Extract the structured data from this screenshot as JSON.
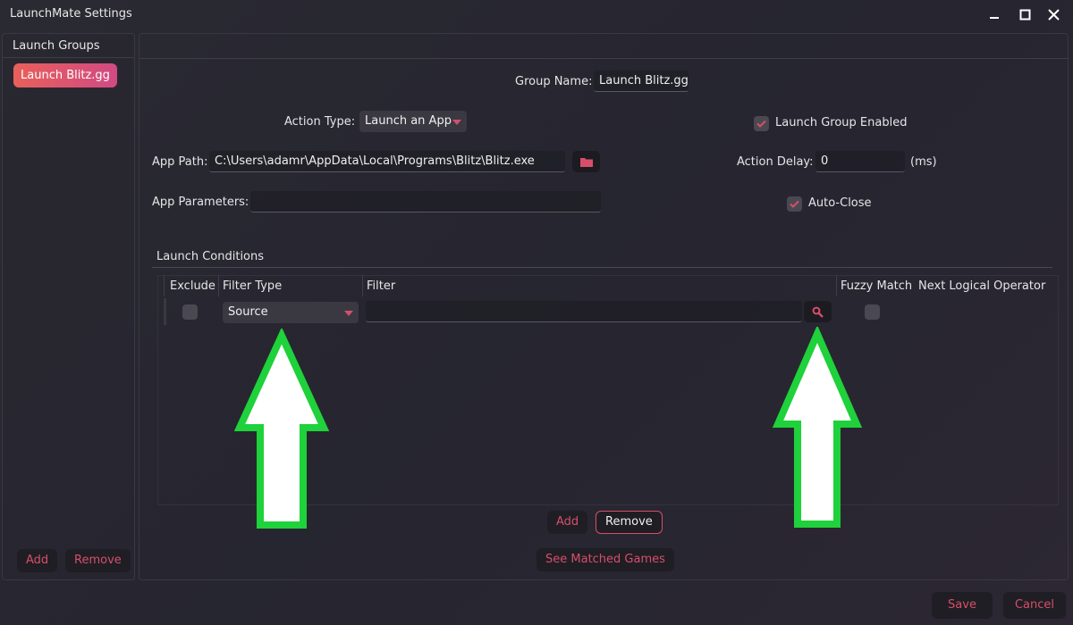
{
  "window": {
    "title": "LaunchMate Settings"
  },
  "sidebar": {
    "title": "Launch Groups",
    "groups": [
      {
        "label": "Launch Blitz.gg"
      }
    ],
    "add_label": "Add",
    "remove_label": "Remove"
  },
  "form": {
    "group_name_label": "Group Name:",
    "group_name_value": "Launch Blitz.gg",
    "action_type_label": "Action Type:",
    "action_type_value": "Launch an App",
    "launch_group_enabled_label": "Launch Group Enabled",
    "launch_group_enabled_checked": true,
    "app_path_label": "App Path:",
    "app_path_value": "C:\\Users\\adamr\\AppData\\Local\\Programs\\Blitz\\Blitz.exe",
    "action_delay_label": "Action Delay:",
    "action_delay_value": "0",
    "action_delay_unit": "(ms)",
    "app_parameters_label": "App Parameters:",
    "app_parameters_value": "",
    "auto_close_label": "Auto-Close",
    "auto_close_checked": true
  },
  "conditions": {
    "title": "Launch Conditions",
    "columns": [
      "Exclude",
      "Filter Type",
      "Filter",
      "Fuzzy Match",
      "Next Logical Operator"
    ],
    "rows": [
      {
        "exclude": false,
        "filter_type": "Source",
        "filter": "",
        "fuzzy_match": false,
        "next_logical_operator": ""
      }
    ],
    "add_label": "Add",
    "remove_label": "Remove",
    "see_matched_label": "See Matched Games"
  },
  "footer": {
    "save_label": "Save",
    "cancel_label": "Cancel"
  },
  "colors": {
    "accent": "#d64f6a",
    "annotation_arrow": "#1fd13a",
    "background": "#28272f"
  }
}
